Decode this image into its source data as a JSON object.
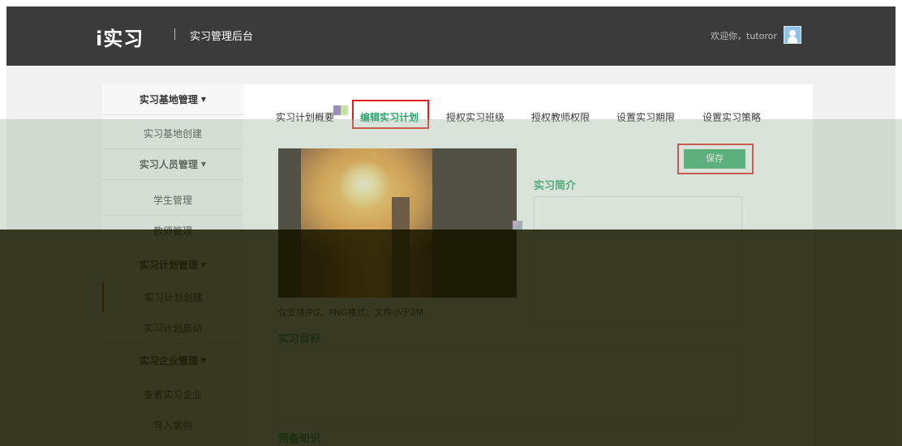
{
  "header": {
    "logo": "i实习",
    "app_name": "实习管理后台",
    "welcome": "欢迎你，tutoror"
  },
  "sidebar": {
    "items": [
      {
        "label": "实习基地管理",
        "group": true
      },
      {
        "label": "实习基地创建",
        "group": false
      },
      {
        "label": "实习人员管理",
        "group": true
      },
      {
        "label": "学生管理",
        "group": false
      },
      {
        "label": "教师管理",
        "group": false
      },
      {
        "label": "实习计划管理",
        "group": true
      },
      {
        "label": "实习计划创建",
        "group": false,
        "active": true
      },
      {
        "label": "实习计划启动",
        "group": false
      },
      {
        "label": "实习企业管理",
        "group": true
      },
      {
        "label": "查看实习企业",
        "group": false
      },
      {
        "label": "导入案例",
        "group": false
      }
    ]
  },
  "tabs": [
    {
      "label": "实习计划概要"
    },
    {
      "label": "编辑实习计划",
      "active": true
    },
    {
      "label": "授权实习班级"
    },
    {
      "label": "授权教师权限"
    },
    {
      "label": "设置实习期限"
    },
    {
      "label": "设置实习策略"
    }
  ],
  "form": {
    "save_label": "保存",
    "upload_hint": "仅支持JPG、PNG格式，文件小于2M",
    "intro_title": "实习简介",
    "goal_title": "实习目标",
    "knowledge_title": "预备知识"
  },
  "colors": {
    "accent": "#21a366",
    "save_button": "#30a868",
    "highlight": "#e02020",
    "header": "#3b3b3b"
  }
}
